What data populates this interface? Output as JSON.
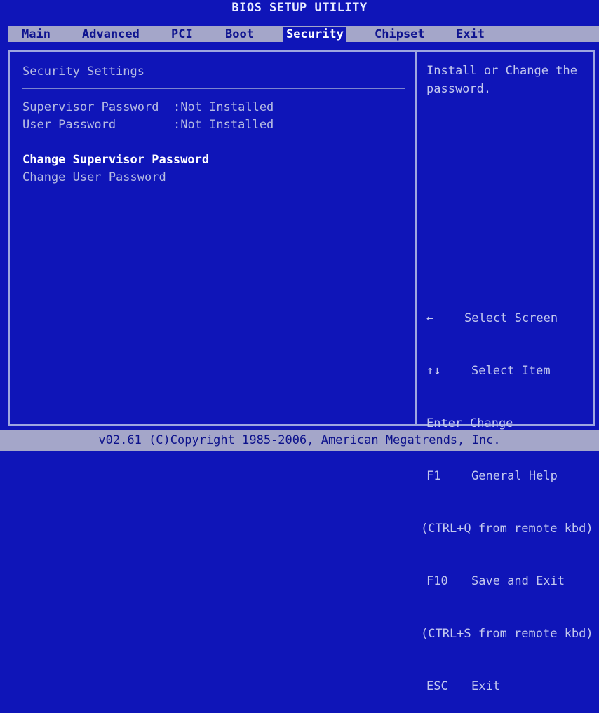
{
  "title": "BIOS SETUP UTILITY",
  "tabs": [
    "Main",
    "Advanced",
    "PCI",
    "Boot",
    "Security",
    "Chipset",
    "Exit"
  ],
  "active_tab": "Security",
  "main": {
    "heading": "Security Settings",
    "supervisor_password_label": "Supervisor Password",
    "supervisor_password_value": ":Not Installed",
    "user_password_label": "User Password",
    "user_password_value": ":Not Installed",
    "change_supervisor": "Change Supervisor Password",
    "change_user": "Change User Password"
  },
  "help": {
    "text": "Install or Change the password."
  },
  "keys": [
    {
      "key": "←",
      "desc": "Select Screen"
    },
    {
      "key": "↑↓",
      "desc": "Select Item"
    },
    {
      "key": "Enter",
      "desc": "Change"
    },
    {
      "key": "F1",
      "desc": "General Help"
    },
    {
      "key": "",
      "desc": "(CTRL+Q from remote kbd)"
    },
    {
      "key": "F10",
      "desc": "Save and Exit"
    },
    {
      "key": "",
      "desc": "(CTRL+S from remote kbd)"
    },
    {
      "key": "ESC",
      "desc": "Exit"
    }
  ],
  "footer": "v02.61 (C)Copyright 1985-2006, American Megatrends, Inc.",
  "colors": {
    "background": "#0f15b8",
    "menu_bar": "#a4a6c9",
    "selected_text": "#ffffff",
    "normal_text": "#b6bce2"
  }
}
